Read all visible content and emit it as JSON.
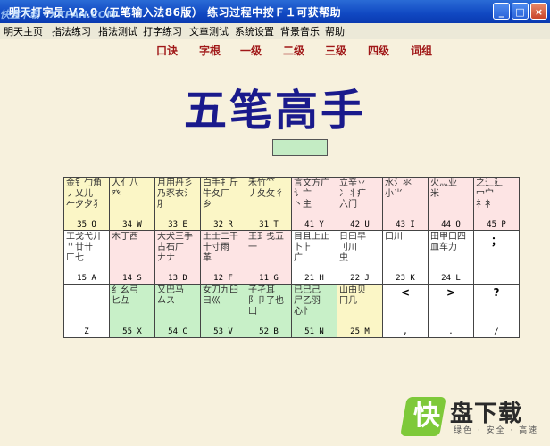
{
  "window": {
    "title": "明天打字员 V2.0（五笔输入法86版）        练习过程中按Ｆ１可获帮助",
    "watermark": "快盘下载 · XKPAN.COM",
    "minimize": "_",
    "maximize": "□",
    "close": "×"
  },
  "menu": [
    "明天主页",
    "指法练习",
    "指法测试",
    "打字练习",
    "文章测试",
    "系统设置",
    "背景音乐",
    "帮助"
  ],
  "toplinks": [
    "口诀",
    "字根",
    "一级",
    "二级",
    "三级",
    "四级",
    "词组"
  ],
  "main_title": "五笔高手",
  "keyboard": {
    "row1": [
      {
        "roots": "金钅勹角\n丿乂儿\n𠂉夕夕犭",
        "label": "35 Q"
      },
      {
        "roots": "人亻八\n癶",
        "label": "34 W"
      },
      {
        "roots": "月用丹彡\n乃豕衣氵\n⺼",
        "label": "33 E"
      },
      {
        "roots": "白手扌斤\n牛夂厂\n乡",
        "label": "32 R"
      },
      {
        "roots": "禾竹𥫗\n丿夂攵彳\n",
        "label": "31 T"
      },
      {
        "roots": "言文方广\n讠亠\n丶主",
        "label": "41 Y"
      },
      {
        "roots": "立辛丷\n冫丬疒\n六门",
        "label": "42 U"
      },
      {
        "roots": "水氵氺\n小⺌\n",
        "label": "43 I"
      },
      {
        "roots": "火灬业\n米",
        "label": "44 O"
      },
      {
        "roots": "之辶廴\n冖宀\n礻衤",
        "label": "45 P"
      }
    ],
    "row2": [
      {
        "roots": "工戈弋廾\n艹廿卄\n匚七",
        "label": "15 A"
      },
      {
        "roots": "木丁西\n",
        "label": "14 S"
      },
      {
        "roots": "大犬三手\n古石厂\n𠂇ナ",
        "label": "13 D"
      },
      {
        "roots": "土士二干\n十寸雨\n革",
        "label": "12 F"
      },
      {
        "roots": "王𤣩戋五\n一",
        "label": "11 G"
      },
      {
        "roots": "目且上止\n卜⺊\n广",
        "label": "21 H"
      },
      {
        "roots": "日曰早\n刂川\n虫",
        "label": "22 J"
      },
      {
        "roots": "口川",
        "label": "23 K"
      },
      {
        "roots": "田甲口四\n皿车力\n",
        "label": "24 L"
      },
      {
        "punct": "；",
        "label": ""
      }
    ],
    "row3": [
      {
        "big": "",
        "label": "Z"
      },
      {
        "roots": "纟幺弓\n匕彑\n",
        "label": "55 X"
      },
      {
        "roots": "又巴马\n厶ス\n",
        "label": "54 C"
      },
      {
        "roots": "女刀九臼\n彐巛\n",
        "label": "53 V"
      },
      {
        "roots": "子孑耳\n阝卩了也\n凵",
        "label": "52 B"
      },
      {
        "roots": "已巳己\n尸乙羽\n心忄",
        "label": "51 N"
      },
      {
        "roots": "山由贝\n冂几\n",
        "label": "25 M"
      },
      {
        "punct": "<",
        "label": ","
      },
      {
        "punct": ">",
        "label": "."
      },
      {
        "punct": "?",
        "label": "/"
      }
    ]
  },
  "branding": {
    "logo_char": "快",
    "name": "盘下载",
    "tagline": "绿色 · 安全 · 高速"
  },
  "colors": {
    "titlebar": "#1048c2",
    "link": "#a01818",
    "main_title": "#1a1a8c",
    "input_box": "#c4ecc4"
  }
}
